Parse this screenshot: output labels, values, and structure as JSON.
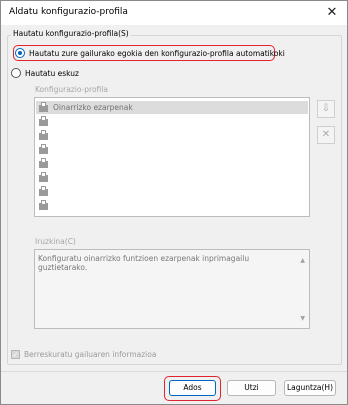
{
  "dialog": {
    "title": "Aldatu konfigurazio-profila"
  },
  "group": {
    "label": "Hautatu konfigurazio-profila(S)",
    "radio_auto": "Hautatu zure gailurako egokia den konfigurazio-profila automatikoki",
    "radio_manual": "Hautatu eskuz"
  },
  "profiles": {
    "label": "Konfigurazio-profila",
    "items": [
      "Oinarrizko ezarpenak",
      "",
      "",
      "",
      "",
      "",
      "",
      ""
    ]
  },
  "description": {
    "label": "Iruzkina(C)",
    "text": "Konfiguratu oinarrizko funtzioen ezarpenak inprimagailu guztietarako."
  },
  "checkbox": {
    "label": "Berreskuratu gailuaren informazioa"
  },
  "buttons": {
    "ok": "Ados",
    "cancel": "Utzi",
    "help": "Laguntza(H)"
  },
  "icons": {
    "close": "close-icon",
    "printer": "printer-icon",
    "import": "import-icon",
    "delete": "delete-icon"
  },
  "colors": {
    "accent": "#0067c0",
    "highlight": "#e0242f"
  }
}
